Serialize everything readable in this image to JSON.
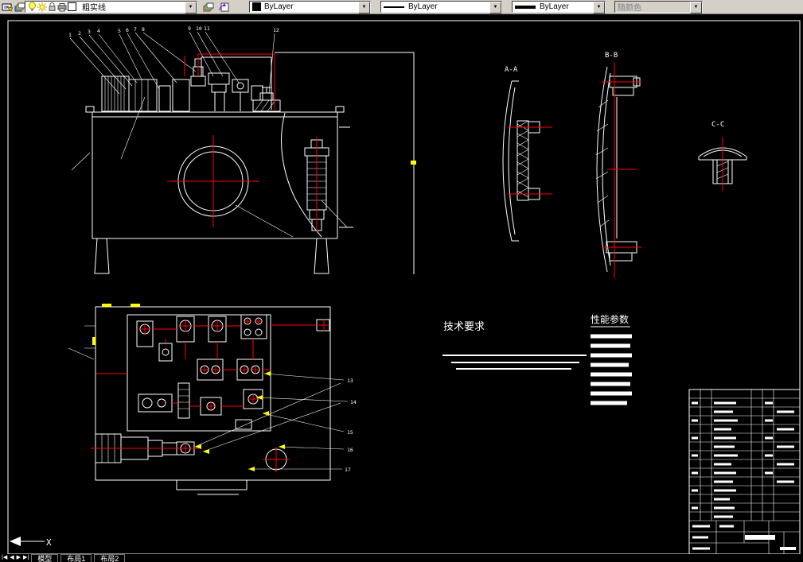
{
  "toolbar": {
    "layer_control": "粗实线",
    "color_control": "ByLayer",
    "linetype_control": "ByLayer",
    "lineweight_control": "ByLayer",
    "plot_style_control": "随颜色"
  },
  "drawing": {
    "sections": {
      "aa": "A-A",
      "bb": "B-B",
      "cc": "C-C"
    },
    "tech_requirements_title": "技术要求",
    "performance_params_title": "性能参数",
    "ucs_axis_label": "X",
    "callouts": [
      "1",
      "2",
      "3",
      "4",
      "5",
      "6",
      "7",
      "8",
      "9",
      "10",
      "11",
      "12"
    ],
    "side_callouts": [
      "13",
      "14",
      "15",
      "16",
      "17"
    ]
  },
  "status_bar": {
    "nav_icons": [
      "|◀",
      "◀",
      "▶",
      "▶|"
    ],
    "tabs": [
      "模型",
      "布局1",
      "布局2"
    ]
  },
  "colors": {
    "background": "#000000",
    "line": "#ffffff",
    "centerline": "#ff0000",
    "highlight": "#ffff00",
    "toolbar_bg": "#d4d0c8"
  }
}
